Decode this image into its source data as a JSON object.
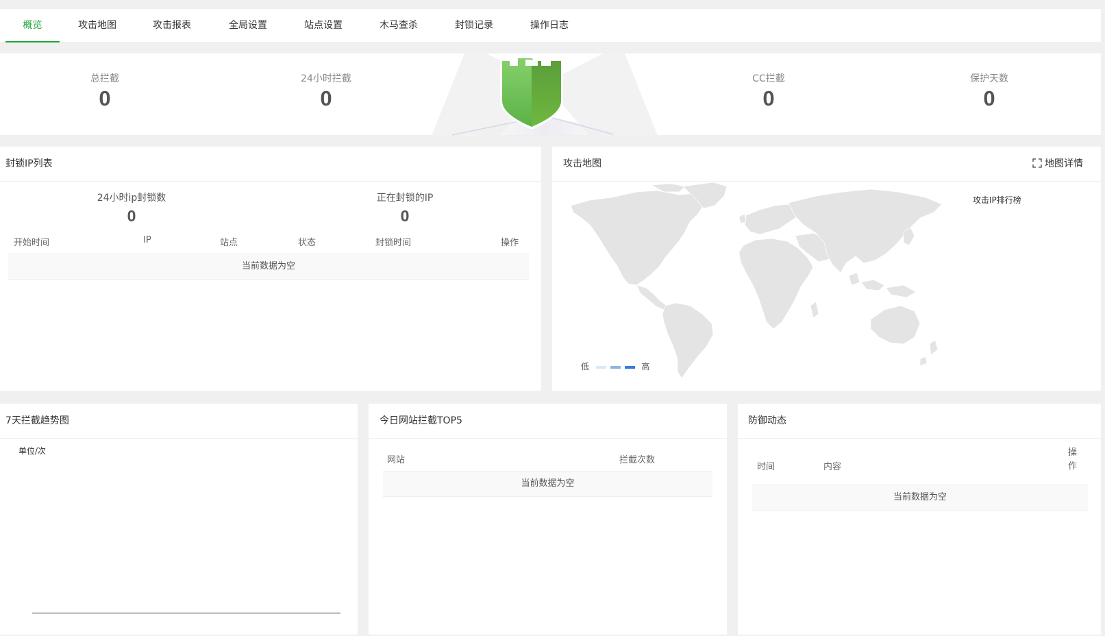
{
  "tabs": [
    "概览",
    "攻击地图",
    "攻击报表",
    "全局设置",
    "站点设置",
    "木马查杀",
    "封锁记录",
    "操作日志"
  ],
  "active_tab": 0,
  "stats": {
    "total_label": "总拦截",
    "total_value": "0",
    "h24_label": "24小时拦截",
    "h24_value": "0",
    "cc_label": "CC拦截",
    "cc_value": "0",
    "days_label": "保护天数",
    "days_value": "0"
  },
  "blocked": {
    "title": "封锁IP列表",
    "h24_label": "24小时ip封锁数",
    "h24_value": "0",
    "current_label": "正在封锁的IP",
    "current_value": "0",
    "columns": [
      "开始时间",
      "IP",
      "站点",
      "状态",
      "封锁时间",
      "操作"
    ],
    "empty": "当前数据为空"
  },
  "attack_map": {
    "title": "攻击地图",
    "detail_label": "地图详情",
    "rank_title": "攻击IP排行榜",
    "legend_low": "低",
    "legend_high": "高"
  },
  "trend": {
    "title": "7天拦截趋势图",
    "unit": "单位/次"
  },
  "top5": {
    "title": "今日网站拦截TOP5",
    "columns": [
      "网站",
      "拦截次数"
    ],
    "empty": "当前数据为空"
  },
  "defense": {
    "title": "防御动态",
    "columns": [
      "时间",
      "内容",
      "操作"
    ],
    "empty": "当前数据为空"
  },
  "colors": {
    "accent": "#20a53a",
    "map_land": "#e4e4e4",
    "legend_light": "#dbe8f7",
    "legend_mid": "#8fb4e3",
    "legend_dark": "#3a7bd5"
  }
}
